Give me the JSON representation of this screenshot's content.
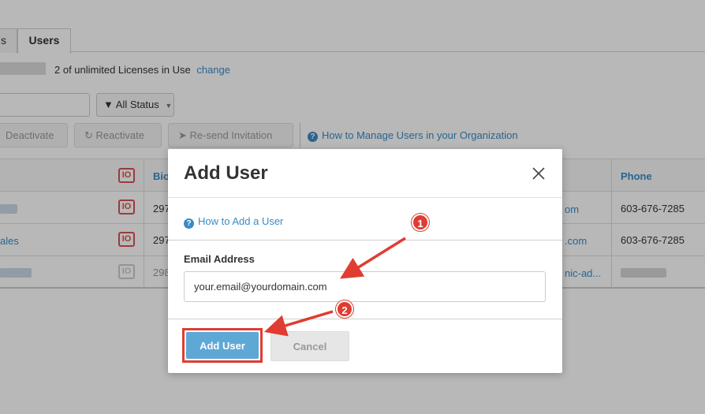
{
  "tabs": [
    {
      "label": "s"
    },
    {
      "label": "Users"
    }
  ],
  "license": {
    "text": "2 of unlimited Licenses in Use",
    "change_link": "change"
  },
  "filters": {
    "status_label": "All Status"
  },
  "actions": {
    "deactivate": "Deactivate",
    "reactivate": "Reactivate",
    "resend": "Re-send Invitation",
    "help_link": "How to Manage Users in your Organization"
  },
  "table": {
    "headers": {
      "bio": "Bio",
      "phone": "Phone"
    },
    "rows": [
      {
        "name": "",
        "id": "297",
        "email": "om",
        "phone": "603-676-7285"
      },
      {
        "name": "ales",
        "id": "297",
        "email": ".com",
        "phone": "603-676-7285"
      },
      {
        "name": "",
        "id": "298",
        "email": "nic-ad...",
        "phone": ""
      }
    ],
    "icon_text": "IO"
  },
  "modal": {
    "title": "Add User",
    "help_link": "How to Add a User",
    "email_label": "Email Address",
    "email_value": "your.email@yourdomain.com",
    "add_button": "Add User",
    "cancel_button": "Cancel"
  },
  "annotations": {
    "badge1": "1",
    "badge2": "2",
    "color": "#e03c31"
  },
  "colors": {
    "link": "#3a8bc5",
    "primary_button": "#5ea8d6",
    "danger": "#d9534f"
  }
}
